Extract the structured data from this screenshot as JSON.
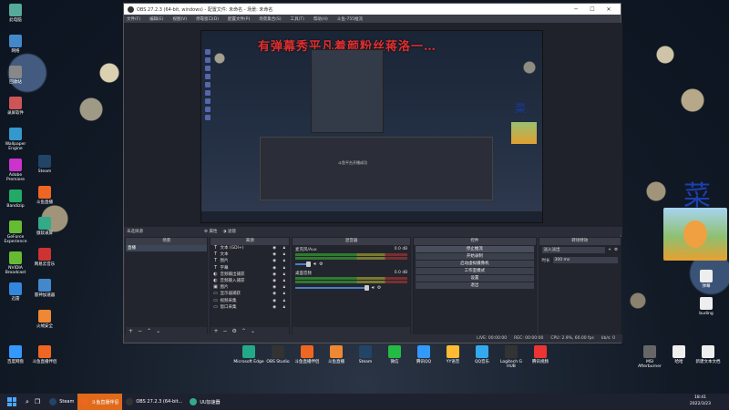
{
  "obs": {
    "title": "OBS 27.2.3 (64-bit, windows) - 配置文件: 未命名 - 场景: 未命名",
    "menu": [
      "文件(F)",
      "编辑(E)",
      "视图(V)",
      "停靠窗口(D)",
      "配置文件(P)",
      "场景集合(S)",
      "工具(T)",
      "帮助(H)",
      "斗鱼-755推流"
    ],
    "overlay_text": "有弹幕秀平凡着颜粉丝蒋洛一…",
    "inner_message": "斗鱼平台开播成功",
    "preview_bar": {
      "label": "未选择源",
      "props": "属性",
      "filters": "滤镜"
    },
    "docks": {
      "scenes": {
        "title": "场景",
        "items": [
          "直播"
        ]
      },
      "sources": {
        "title": "来源",
        "items": [
          {
            "icon": "T",
            "name": "文本 (GDI+)"
          },
          {
            "icon": "T",
            "name": "文本"
          },
          {
            "icon": "T",
            "name": "图片"
          },
          {
            "icon": "T",
            "name": "字幕"
          },
          {
            "icon": "◐",
            "name": "音频输出捕获"
          },
          {
            "icon": "◐",
            "name": "音频输入捕获"
          },
          {
            "icon": "▣",
            "name": "图片"
          },
          {
            "icon": "▭",
            "name": "显示器捕获"
          },
          {
            "icon": "▭",
            "name": "视频采集"
          },
          {
            "icon": "▭",
            "name": "窗口采集"
          }
        ]
      },
      "mixer": {
        "title": "混音器",
        "tracks": [
          {
            "name": "麦克风/Aux",
            "db": "0.0 dB",
            "level": 0.2
          },
          {
            "name": "桌面音频",
            "db": "0.0 dB",
            "level": 0.95
          }
        ]
      },
      "controls": {
        "title": "控件",
        "buttons": [
          "停止推流",
          "开始录制",
          "启动虚拟摄像机",
          "工作室模式",
          "设置",
          "退出"
        ]
      },
      "transitions": {
        "title": "转场特效",
        "type": "淡入淡出",
        "duration_label": "时长",
        "duration": "300 ms"
      }
    },
    "status": {
      "live": "LIVE: 00:00:00",
      "rec": "REC: 00:00:00",
      "cpu": "CPU: 2.9%, 60.00 fps",
      "kbps": "kb/s: 0"
    }
  },
  "desktop_icons_left": [
    "此电脑",
    "网络",
    "回收站",
    "录屏软件",
    "Wallpaper Engine",
    "Adobe Premiere",
    "Bandizip",
    "GeForce Experience",
    "NVIDIA Broadcast",
    "迅雷"
  ],
  "desktop_icons_left2": [
    "Steam",
    "斗鱼直播",
    "傲软录屏",
    "网易云音乐",
    "雷神加速器",
    "火绒安全"
  ],
  "desktop_icons_bottom": [
    "百度网盘",
    "斗鱼直播伴侣",
    "Microsoft Edge",
    "OBS Studio",
    "斗鱼直播伴侣",
    "斗鱼直播",
    "Steam",
    "微信",
    "腾讯QQ",
    "YY语音",
    "QQ音乐",
    "Logitech G HUB",
    "腾讯视频",
    "MSI Afterburner",
    "哈哈",
    "新建文本文档"
  ],
  "desktop_right_icons": [
    "弹幕",
    "buding"
  ],
  "right_char": "菜",
  "taskbar": {
    "apps": [
      "Steam",
      "斗鱼直播伴侣",
      "OBS 27.2.3 (64-bit...",
      "UU加速器"
    ],
    "time": "18:41",
    "date": "2022/3/23"
  }
}
